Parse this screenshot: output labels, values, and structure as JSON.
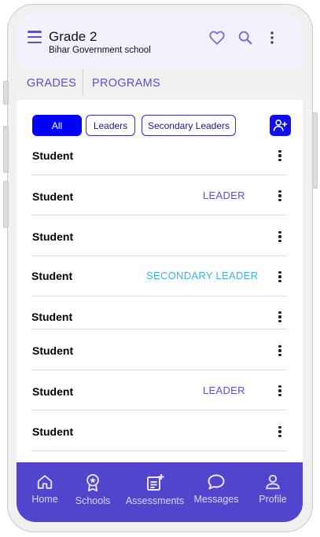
{
  "appbar": {
    "title": "Grade 2",
    "subtitle": "Bihar Government school",
    "icons": [
      "menu-icon",
      "heart-icon",
      "search-icon",
      "more-vertical-icon"
    ]
  },
  "tabs": [
    {
      "label": "GRADES"
    },
    {
      "label": "PROGRAMS"
    }
  ],
  "filters": [
    {
      "label": "All",
      "active": true
    },
    {
      "label": "Leaders",
      "active": false
    },
    {
      "label": "Secondary Leaders",
      "active": false
    }
  ],
  "add_student_icon": "add-user-icon",
  "students": [
    {
      "name": "Student",
      "badge": ""
    },
    {
      "name": "Student",
      "badge": "LEADER"
    },
    {
      "name": "Student",
      "badge": ""
    },
    {
      "name": "Student",
      "badge": "SECONDARY LEADER"
    },
    {
      "name": "Student",
      "badge": ""
    },
    {
      "name": "Student",
      "badge": ""
    },
    {
      "name": "Student",
      "badge": "LEADER"
    },
    {
      "name": "Student",
      "badge": ""
    }
  ],
  "colors": {
    "accent": "#5145cd",
    "leader": "#5a4fcf",
    "secondary_leader": "#3fb2e6",
    "filter_active": "#0000ff"
  },
  "bottom_nav": [
    {
      "label": "Home",
      "icon": "home-icon"
    },
    {
      "label": "Schools",
      "icon": "badge-icon"
    },
    {
      "label": "Assessments",
      "icon": "assessment-icon"
    },
    {
      "label": "Messages",
      "icon": "chat-icon"
    },
    {
      "label": "Profile",
      "icon": "profile-icon"
    }
  ]
}
